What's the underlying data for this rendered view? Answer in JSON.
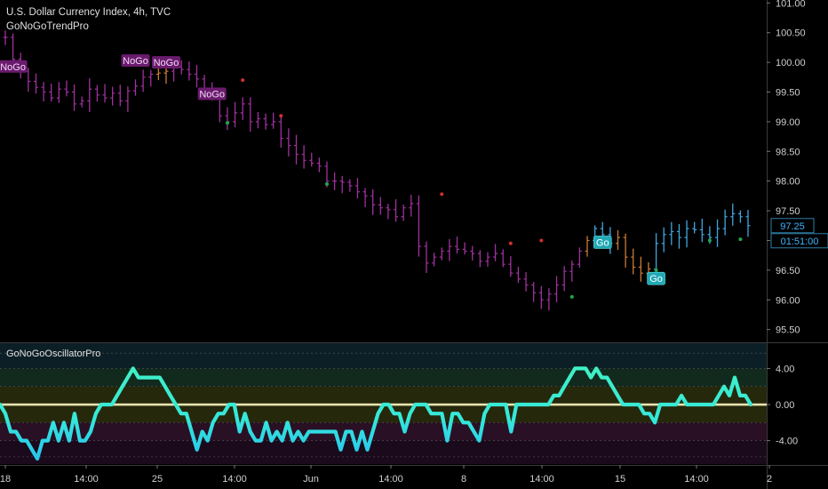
{
  "header": {
    "title": "U.S. Dollar Currency Index, 4h, TVC",
    "indicator": "GoNoGoTrendPro",
    "osc_indicator": "GoNoGoOscillatorPro"
  },
  "colors": {
    "background": "#000000",
    "nogo_bar": "#a0309e",
    "nogo_strong": "#5e1b72",
    "go_bar": "#3fa6e0",
    "neutral_bar": "#c87a36",
    "nogo_badge": "#6a1b6e",
    "go_badge": "#21a8b4",
    "red_dot": "#d13030",
    "green_dot": "#1ea84a",
    "osc_line_top": "#3ff0c6",
    "osc_line_bottom": "#26c6ee",
    "zero_line": "#e8e2b0"
  },
  "chart_data": [
    {
      "type": "candlestick",
      "title": "U.S. Dollar Currency Index, 4h, TVC",
      "y_ticks": [
        "101.00",
        "100.50",
        "100.00",
        "99.50",
        "99.00",
        "98.50",
        "98.00",
        "97.50",
        "97.00",
        "96.50",
        "96.00",
        "95.50"
      ],
      "ylim": [
        95.3,
        101.05
      ],
      "x_ticks": [
        "18",
        "14:00",
        "25",
        "14:00",
        "Jun",
        "14:00",
        "8",
        "14:00",
        "15",
        "14:00",
        "2"
      ],
      "last_price_label": "97.25",
      "countdown_label": "01:51:00",
      "close_series": [
        100.42,
        100.05,
        99.85,
        99.68,
        99.58,
        99.5,
        99.4,
        99.55,
        99.5,
        99.3,
        99.35,
        99.55,
        99.45,
        99.4,
        99.48,
        99.35,
        99.52,
        99.6,
        99.75,
        99.8,
        99.82,
        99.85,
        99.92,
        99.88,
        99.8,
        99.72,
        99.55,
        99.42,
        99.1,
        99.0,
        99.15,
        99.3,
        99.0,
        99.05,
        98.95,
        99.0,
        98.72,
        98.6,
        98.45,
        98.35,
        98.3,
        98.25,
        98.0,
        98.0,
        97.98,
        97.92,
        97.82,
        97.75,
        97.6,
        97.55,
        97.52,
        97.4,
        97.55,
        97.62,
        96.9,
        96.62,
        96.72,
        96.82,
        96.9,
        96.85,
        96.82,
        96.78,
        96.65,
        96.72,
        96.78,
        96.6,
        96.45,
        96.35,
        96.25,
        96.12,
        96.0,
        96.1,
        96.25,
        96.48,
        96.6,
        96.82,
        97.0,
        97.2,
        97.1,
        96.95,
        97.05,
        96.72,
        96.55,
        96.45,
        96.52,
        96.95,
        97.1,
        97.15,
        97.05,
        97.2,
        97.18,
        97.1,
        97.05,
        97.2,
        97.4,
        97.45,
        97.4,
        97.25
      ],
      "bar_states": [
        "nogo",
        "nogo",
        "nogo",
        "nogo",
        "nogo",
        "nogo",
        "nogo",
        "nogo",
        "nogo",
        "nogo",
        "nogo",
        "nogo",
        "nogo",
        "nogo",
        "nogo",
        "nogo",
        "nogo",
        "nogo",
        "nogo",
        "nogo",
        "neutral",
        "neutral",
        "nogo",
        "nogo",
        "nogo",
        "nogo",
        "nogo",
        "nogo",
        "nogo",
        "nogo",
        "nogo",
        "nogo",
        "nogo",
        "nogo",
        "nogo",
        "nogo",
        "nogo",
        "nogo",
        "nogo",
        "nogo",
        "nogo",
        "nogo",
        "nogo",
        "nogo",
        "nogo",
        "nogo",
        "nogo",
        "nogo",
        "nogo",
        "nogo",
        "nogo",
        "nogo",
        "nogo",
        "nogo",
        "nogo",
        "nogo",
        "nogo",
        "nogo",
        "nogo",
        "nogo",
        "nogo",
        "nogo",
        "nogo",
        "nogo",
        "nogo",
        "nogo",
        "nogo",
        "nogo",
        "nogo",
        "nogo",
        "nogo",
        "nogo",
        "nogo",
        "nogo",
        "nogo",
        "nogo",
        "neutral",
        "go",
        "go",
        "go",
        "neutral",
        "neutral",
        "neutral",
        "neutral",
        "neutral",
        "go",
        "go",
        "go",
        "go",
        "go",
        "go",
        "go",
        "go",
        "go",
        "go",
        "go",
        "go",
        "go"
      ],
      "badges": [
        {
          "label": "NoGo",
          "index": 1,
          "price": 99.93,
          "kind": "nogo"
        },
        {
          "label": "NoGo",
          "index": 17,
          "price": 100.03,
          "kind": "nogo"
        },
        {
          "label": "NoGo",
          "index": 21,
          "price": 100.0,
          "kind": "nogo"
        },
        {
          "label": "NoGo",
          "index": 27,
          "price": 99.47,
          "kind": "nogo"
        },
        {
          "label": "Go",
          "index": 78,
          "price": 96.97,
          "kind": "go"
        },
        {
          "label": "Go",
          "index": 85,
          "price": 96.36,
          "kind": "go"
        }
      ],
      "dots": [
        {
          "index": 31,
          "price": 99.7,
          "kind": "red"
        },
        {
          "index": 36,
          "price": 99.1,
          "kind": "red"
        },
        {
          "index": 57,
          "price": 97.78,
          "kind": "red"
        },
        {
          "index": 66,
          "price": 96.95,
          "kind": "red"
        },
        {
          "index": 70,
          "price": 97.0,
          "kind": "red"
        },
        {
          "index": 29,
          "price": 98.98,
          "kind": "green"
        },
        {
          "index": 42,
          "price": 97.95,
          "kind": "green"
        },
        {
          "index": 74,
          "price": 96.05,
          "kind": "green"
        },
        {
          "index": 85,
          "price": 96.5,
          "kind": "green"
        },
        {
          "index": 92,
          "price": 97.0,
          "kind": "green"
        },
        {
          "index": 96,
          "price": 97.02,
          "kind": "green"
        }
      ]
    },
    {
      "type": "line",
      "title": "GoNoGoOscillatorPro",
      "y_ticks": [
        "4.00",
        "0.00",
        "-4.00"
      ],
      "ylim": [
        -6.6,
        6.8
      ],
      "series": [
        {
          "values": [
            0,
            -1,
            -3,
            -3,
            -4,
            -4,
            -5,
            -6,
            -4,
            -4,
            -2,
            -4,
            -2,
            -4,
            -1,
            -4,
            -4,
            -3,
            -1,
            0,
            0,
            0,
            1,
            2,
            3,
            4,
            3,
            3,
            3,
            3,
            3,
            2,
            1,
            0,
            -1,
            -1,
            -3,
            -5,
            -3,
            -4,
            -2,
            -1,
            -1,
            0,
            0,
            -3,
            -1,
            -3,
            -4,
            -4,
            -2,
            -4,
            -3,
            -4,
            -2,
            -4,
            -3,
            -4,
            -3,
            -3,
            -3,
            -3,
            -3,
            -3,
            -5,
            -3,
            -3,
            -5,
            -3,
            -5,
            -3,
            -1,
            0,
            0,
            -1,
            -1,
            -3,
            -1,
            0,
            0,
            0,
            -1,
            -1,
            -1,
            -4,
            -1,
            -1,
            -2,
            -2,
            -3,
            -4,
            -1,
            0,
            0,
            0,
            0,
            -3,
            0,
            0,
            0,
            0,
            0,
            0,
            0,
            1,
            1,
            2,
            3,
            4,
            4,
            4,
            3,
            4,
            3,
            3,
            2,
            1,
            0,
            0,
            0,
            0,
            -1,
            -1,
            -2,
            0,
            0,
            0,
            0,
            1,
            0,
            0,
            0,
            0,
            0,
            0,
            1,
            2,
            1,
            3,
            1,
            1,
            0
          ]
        }
      ]
    }
  ]
}
